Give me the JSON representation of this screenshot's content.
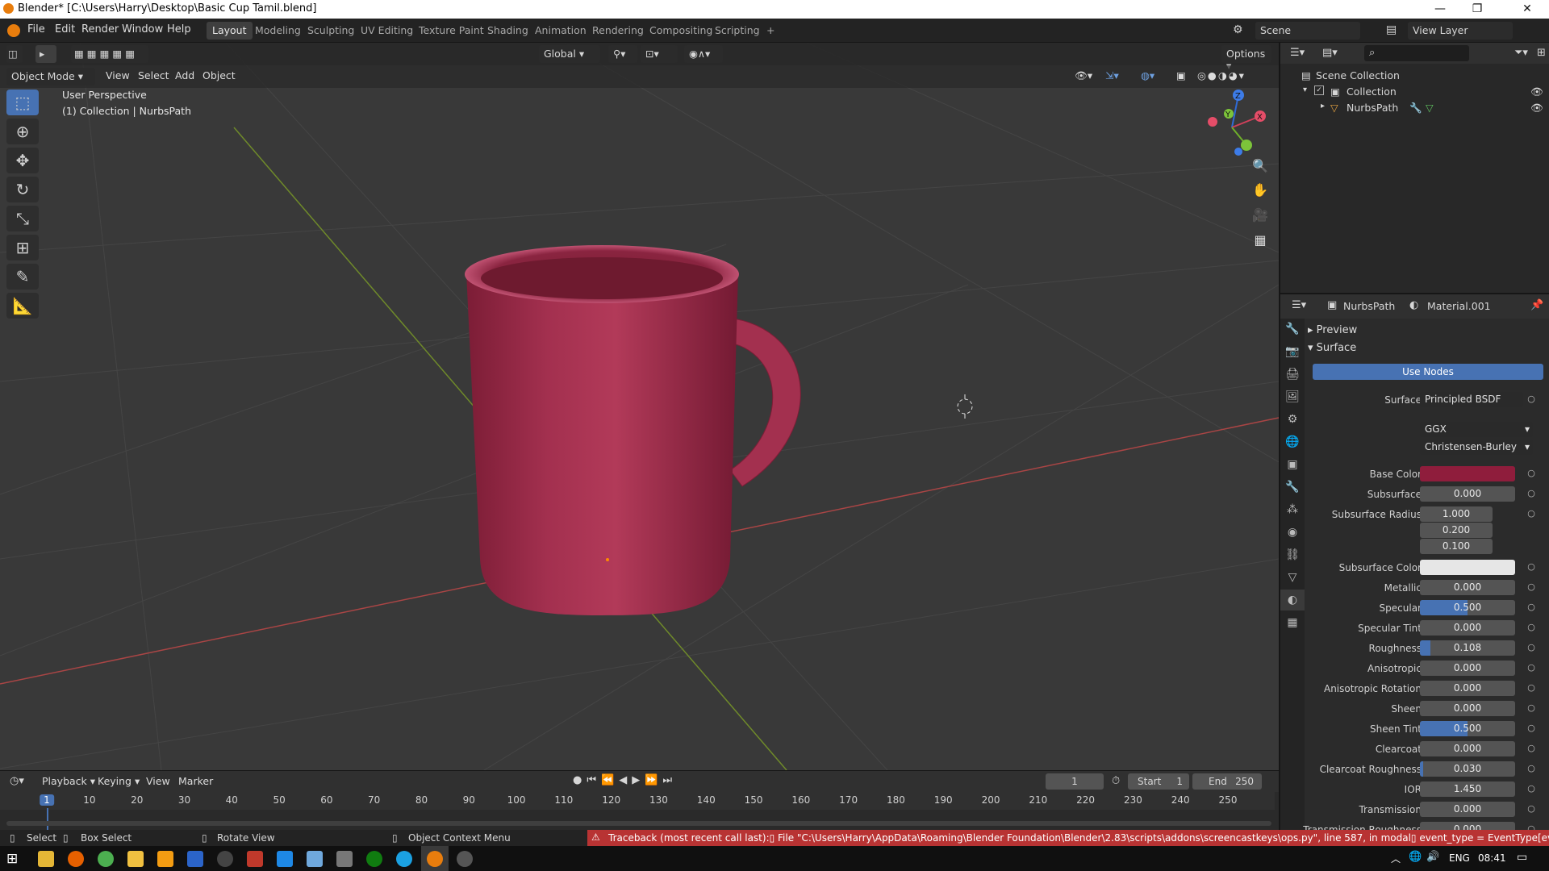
{
  "window": {
    "title": "Blender* [C:\\Users\\Harry\\Desktop\\Basic Cup Tamil.blend]",
    "minimize": "—",
    "maximize": "❐",
    "close": "✕"
  },
  "menus": [
    "File",
    "Edit",
    "Render",
    "Window",
    "Help"
  ],
  "workspaces": {
    "active": "Layout",
    "items": [
      "Layout",
      "Modeling",
      "Sculpting",
      "UV Editing",
      "Texture Paint",
      "Shading",
      "Animation",
      "Rendering",
      "Compositing",
      "Scripting"
    ],
    "add": "+"
  },
  "scene": "Scene",
  "view_layer": "View Layer",
  "viewport": {
    "mode": "Object Mode",
    "menus": [
      "View",
      "Select",
      "Add",
      "Object"
    ],
    "orientation": "Global",
    "options": "Options",
    "overlay_line1": "User Perspective",
    "overlay_line2": "(1) Collection | NurbsPath",
    "gizmo": {
      "x": "X",
      "y": "Y",
      "z": "Z"
    }
  },
  "colors": {
    "accent": "#4772b3",
    "mug": "#9e2948",
    "base_color_swatch": "#8f1d3c",
    "error": "#d94b4b"
  },
  "outliner": {
    "rows": [
      {
        "label": "Scene Collection",
        "icon": "collection-icon"
      },
      {
        "label": "Collection",
        "icon": "collection-icon"
      },
      {
        "label": "NurbsPath",
        "icon": "curve-object-icon"
      }
    ]
  },
  "properties": {
    "object": "NurbsPath",
    "material": "Material.001",
    "panels": {
      "preview": "Preview",
      "surface": "Surface"
    },
    "use_nodes": "Use Nodes",
    "surface_label": "Surface",
    "surface_value": "Principled BSDF",
    "distribution": "GGX",
    "subsurface_method": "Christensen-Burley",
    "fields": [
      {
        "label": "Base Color",
        "value": "",
        "type": "color"
      },
      {
        "label": "Subsurface",
        "value": "0.000",
        "fill": 0
      },
      {
        "label": "Subsurface Radius",
        "value": "1.000",
        "fill": 0
      },
      {
        "label": "",
        "value": "0.200",
        "fill": 0
      },
      {
        "label": "",
        "value": "0.100",
        "fill": 0
      },
      {
        "label": "Subsurface Color",
        "value": "",
        "type": "white"
      },
      {
        "label": "Metallic",
        "value": "0.000",
        "fill": 0
      },
      {
        "label": "Specular",
        "value": "0.500",
        "fill": 0.5
      },
      {
        "label": "Specular Tint",
        "value": "0.000",
        "fill": 0
      },
      {
        "label": "Roughness",
        "value": "0.108",
        "fill": 0.108
      },
      {
        "label": "Anisotropic",
        "value": "0.000",
        "fill": 0
      },
      {
        "label": "Anisotropic Rotation",
        "value": "0.000",
        "fill": 0
      },
      {
        "label": "Sheen",
        "value": "0.000",
        "fill": 0
      },
      {
        "label": "Sheen Tint",
        "value": "0.500",
        "fill": 0.5
      },
      {
        "label": "Clearcoat",
        "value": "0.000",
        "fill": 0
      },
      {
        "label": "Clearcoat Roughness",
        "value": "0.030",
        "fill": 0.03
      },
      {
        "label": "IOR",
        "value": "1.450",
        "fill": 0
      },
      {
        "label": "Transmission",
        "value": "0.000",
        "fill": 0
      },
      {
        "label": "Transmission Roughness",
        "value": "0.000",
        "fill": 0
      }
    ]
  },
  "timeline": {
    "menus": [
      "Playback",
      "Keying",
      "View",
      "Marker"
    ],
    "current_frame": "1",
    "start_label": "Start",
    "start": "1",
    "end_label": "End",
    "end": "250",
    "ruler": [
      "1",
      "10",
      "20",
      "30",
      "40",
      "50",
      "60",
      "70",
      "80",
      "90",
      "100",
      "110",
      "120",
      "130",
      "140",
      "150",
      "160",
      "170",
      "180",
      "190",
      "200",
      "210",
      "220",
      "230",
      "240",
      "250"
    ]
  },
  "statusbar": {
    "select": "Select",
    "box_select": "Box Select",
    "rotate": "Rotate View",
    "context": "Object Context Menu",
    "error": "Traceback (most recent call last):▯  File \"C:\\Users\\Harry\\AppData\\Roaming\\Blender Foundation\\Blender\\2.83\\scripts\\addons\\screencastkeys\\ops.py\", line 587, in modal▯    event_type = EventType[event.type]▯  File \"C:\\Program Files\\Ble"
  },
  "taskbar": {
    "lang": "ENG",
    "time": "08:41"
  }
}
